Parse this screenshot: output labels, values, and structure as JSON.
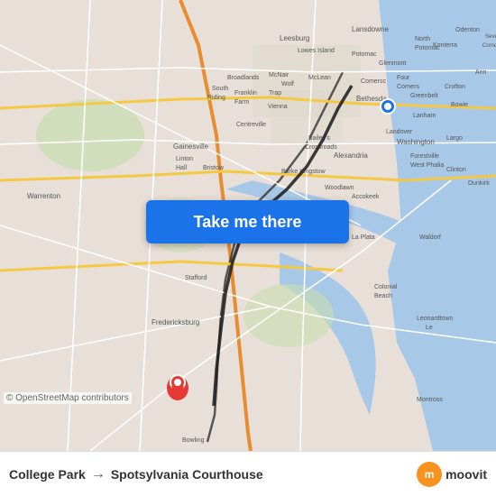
{
  "map": {
    "attribution": "© OpenStreetMap contributors",
    "button_label": "Take me there",
    "button_bg": "#1a73e8"
  },
  "footer": {
    "origin": "College Park",
    "arrow": "→",
    "destination": "Spotsylvania Courthouse",
    "moovit_letter": "m",
    "moovit_text": "moovit"
  }
}
